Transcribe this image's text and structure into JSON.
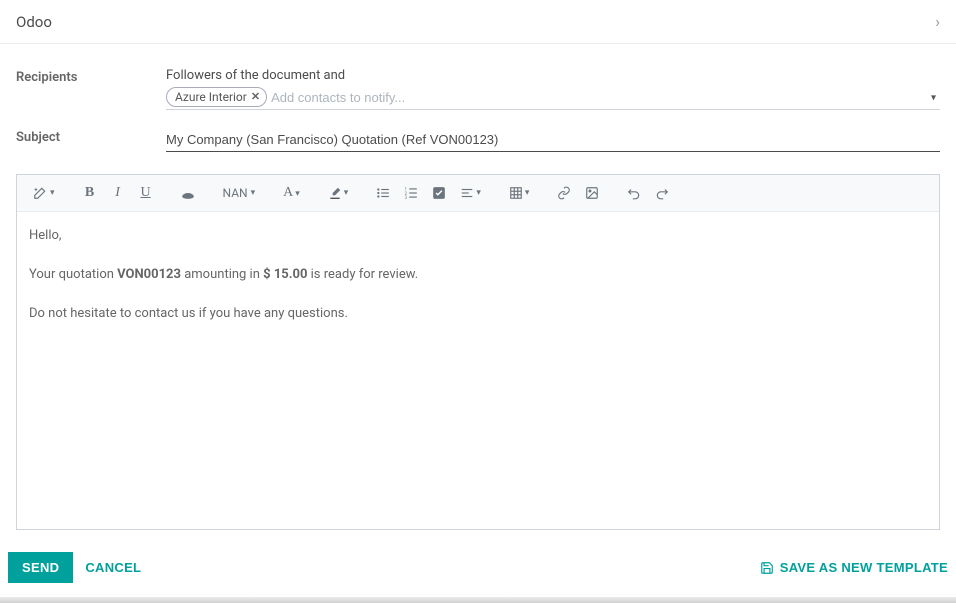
{
  "header": {
    "title": "Odoo"
  },
  "form": {
    "recipients_label": "Recipients",
    "followers_text": "Followers of the document and",
    "recipient_tag": "Azure Interior",
    "recipient_placeholder": "Add contacts to notify...",
    "subject_label": "Subject",
    "subject_value": "My Company (San Francisco) Quotation (Ref VON00123)"
  },
  "toolbar": {
    "sizing_label": "NAN"
  },
  "body": {
    "line1": "Hello,",
    "line2_pre": "Your quotation ",
    "line2_ref": "VON00123",
    "line2_mid": " amounting in ",
    "line2_amount": "$ 15.00",
    "line2_post": " is ready for review.",
    "line3": "Do not hesitate to contact us if you have any questions."
  },
  "footer": {
    "send": "SEND",
    "cancel": "CANCEL",
    "save_template": "SAVE AS NEW TEMPLATE"
  }
}
